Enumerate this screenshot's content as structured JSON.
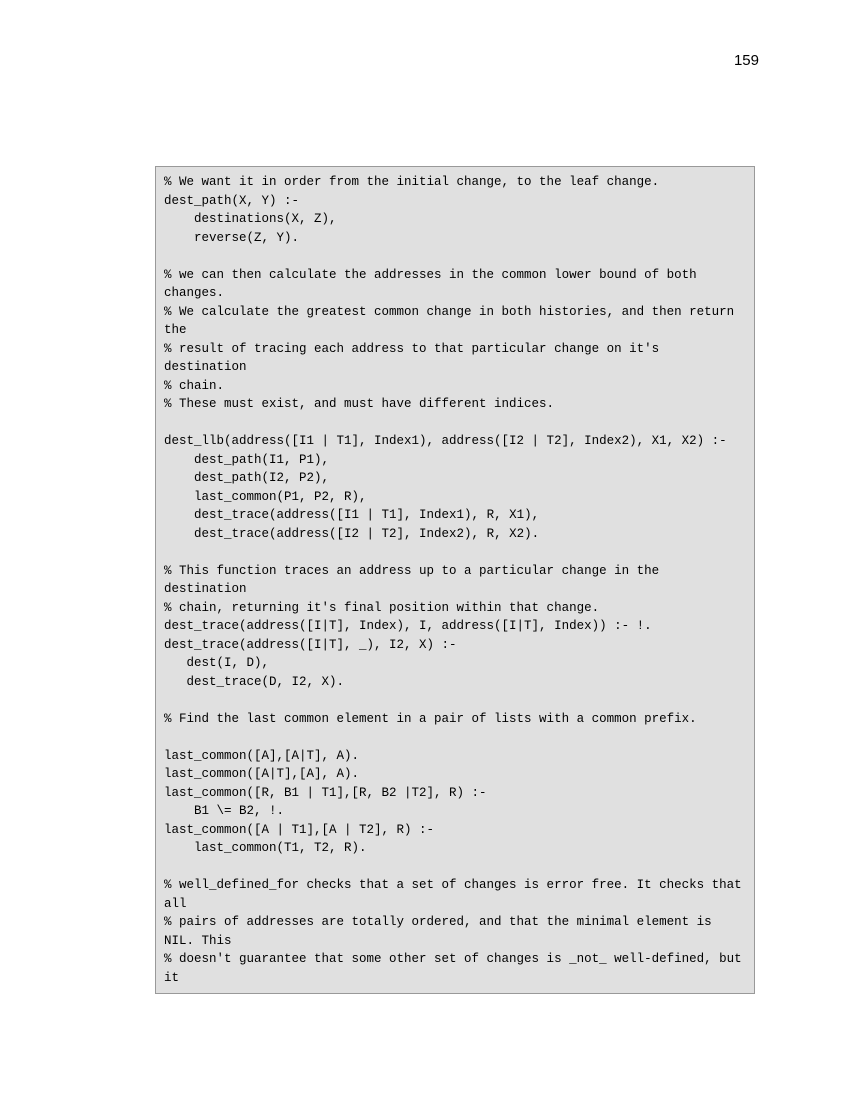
{
  "page_number": "159",
  "code_lines": [
    "% We want it in order from the initial change, to the leaf change.",
    "dest_path(X, Y) :-",
    "    destinations(X, Z),",
    "    reverse(Z, Y).",
    "",
    "% we can then calculate the addresses in the common lower bound of both changes.",
    "% We calculate the greatest common change in both histories, and then return the",
    "% result of tracing each address to that particular change on it's destination",
    "% chain.",
    "% These must exist, and must have different indices.",
    "",
    "dest_llb(address([I1 | T1], Index1), address([I2 | T2], Index2), X1, X2) :-",
    "    dest_path(I1, P1),",
    "    dest_path(I2, P2),",
    "    last_common(P1, P2, R),",
    "    dest_trace(address([I1 | T1], Index1), R, X1),",
    "    dest_trace(address([I2 | T2], Index2), R, X2).",
    "",
    "% This function traces an address up to a particular change in the destination",
    "% chain, returning it's final position within that change.",
    "dest_trace(address([I|T], Index), I, address([I|T], Index)) :- !.",
    "dest_trace(address([I|T], _), I2, X) :-",
    "   dest(I, D),",
    "   dest_trace(D, I2, X).",
    "",
    "% Find the last common element in a pair of lists with a common prefix.",
    "",
    "last_common([A],[A|T], A).",
    "last_common([A|T],[A], A).",
    "last_common([R, B1 | T1],[R, B2 |T2], R) :-",
    "    B1 \\= B2, !.",
    "last_common([A | T1],[A | T2], R) :-",
    "    last_common(T1, T2, R).",
    "",
    "% well_defined_for checks that a set of changes is error free. It checks that all",
    "% pairs of addresses are totally ordered, and that the minimal element is NIL. This",
    "% doesn't guarantee that some other set of changes is _not_ well-defined, but it"
  ]
}
